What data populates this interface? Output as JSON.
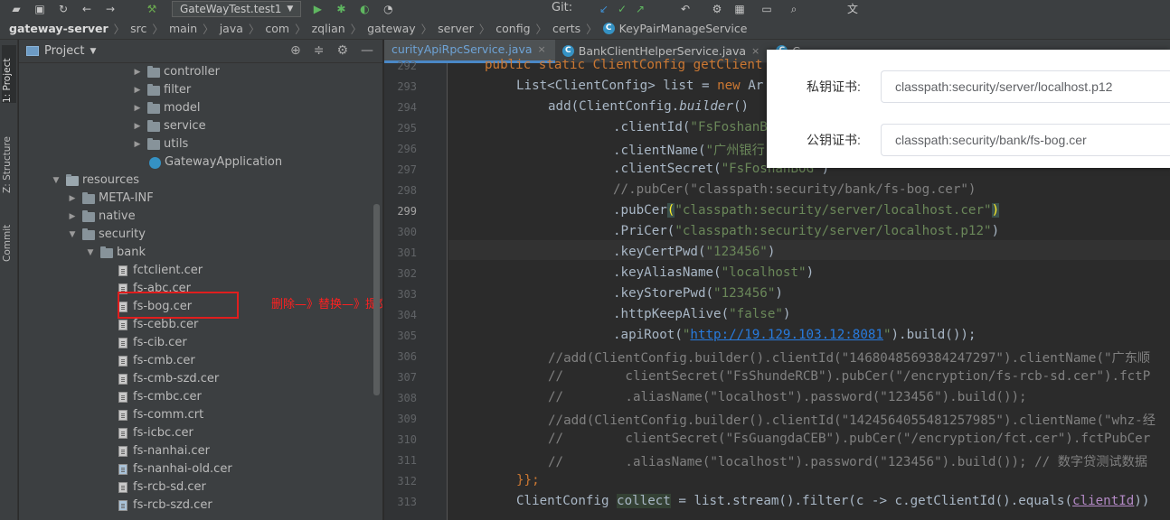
{
  "toolbar": {
    "run_config": "GateWayTest.test1",
    "git_label": "Git:"
  },
  "breadcrumb": [
    "gateway-server",
    "src",
    "main",
    "java",
    "com",
    "zqlian",
    "gateway",
    "server",
    "config",
    "certs",
    "KeyPairManageService"
  ],
  "left_strip": {
    "tabs": [
      "1: Project",
      "Z: Structure",
      "Commit"
    ]
  },
  "project": {
    "title": "Project",
    "tree": [
      {
        "label": "controller",
        "kind": "folder",
        "arrow": "▶"
      },
      {
        "label": "filter",
        "kind": "folder",
        "arrow": "▶"
      },
      {
        "label": "model",
        "kind": "folder",
        "arrow": "▶"
      },
      {
        "label": "service",
        "kind": "folder",
        "arrow": "▶"
      },
      {
        "label": "utils",
        "kind": "folder",
        "arrow": "▶"
      },
      {
        "label": "GatewayApplication",
        "kind": "app",
        "arrow": ""
      },
      {
        "label": "resources",
        "kind": "res",
        "arrow": "▼"
      },
      {
        "label": "META-INF",
        "kind": "folder",
        "arrow": "▶"
      },
      {
        "label": "native",
        "kind": "folder",
        "arrow": "▶"
      },
      {
        "label": "security",
        "kind": "folder",
        "arrow": "▼"
      },
      {
        "label": "bank",
        "kind": "folder",
        "arrow": "▼"
      },
      {
        "label": "fctclient.cer",
        "kind": "file",
        "arrow": ""
      },
      {
        "label": "fs-abc.cer",
        "kind": "file",
        "arrow": ""
      },
      {
        "label": "fs-bog.cer",
        "kind": "file",
        "arrow": ""
      },
      {
        "label": "fs-cebb.cer",
        "kind": "file",
        "arrow": ""
      },
      {
        "label": "fs-cib.cer",
        "kind": "file",
        "arrow": ""
      },
      {
        "label": "fs-cmb.cer",
        "kind": "file",
        "arrow": ""
      },
      {
        "label": "fs-cmb-szd.cer",
        "kind": "file",
        "arrow": ""
      },
      {
        "label": "fs-cmbc.cer",
        "kind": "file",
        "arrow": ""
      },
      {
        "label": "fs-comm.crt",
        "kind": "file",
        "arrow": ""
      },
      {
        "label": "fs-icbc.cer",
        "kind": "file",
        "arrow": ""
      },
      {
        "label": "fs-nanhai.cer",
        "kind": "file",
        "arrow": ""
      },
      {
        "label": "fs-nanhai-old.cer",
        "kind": "gitfile",
        "arrow": ""
      },
      {
        "label": "fs-rcb-sd.cer",
        "kind": "file",
        "arrow": ""
      },
      {
        "label": "fs-rcb-szd.cer",
        "kind": "gitfile",
        "arrow": ""
      }
    ],
    "annotation": "删除—》替换—》提交—》部署"
  },
  "editor": {
    "tabs": [
      {
        "label": "curityApiRpcService.java",
        "active": true
      },
      {
        "label": "BankClientHelperService.java",
        "active": false
      },
      {
        "label": "C",
        "active": false
      }
    ],
    "line_numbers": [
      "292",
      "293",
      "294",
      "295",
      "296",
      "297",
      "298",
      "299",
      "300",
      "301",
      "302",
      "303",
      "304",
      "305",
      "306",
      "307",
      "308",
      "309",
      "310",
      "311",
      "312",
      "313"
    ],
    "current_line": "299",
    "code": {
      "l292": "public static ClientConfig getClient",
      "l293_a": "List<ClientConfig> list = ",
      "l293_b": "new",
      "l293_c": " Ar",
      "l294_a": "add(ClientConfig.",
      "l294_b": "builder",
      "l294_c": "()",
      "l295_a": ".clientId(",
      "l295_b": "\"FsFoshanB",
      "l296_a": ".clientName(",
      "l296_b": "\"广州银行",
      "l297_a": ".clientSecret(",
      "l297_b": "\"FsFoshanBOG\"",
      "l297_c": ")",
      "l298": "//.pubCer(\"classpath:security/bank/fs-bog.cer\")",
      "l299_a": ".pubCer",
      "l299_b": "(",
      "l299_c": "\"classpath:security/server/localhost.cer\"",
      "l299_d": ")",
      "l300_a": ".PriCer(",
      "l300_b": "\"classpath:security/server/localhost.p12\"",
      "l300_c": ")",
      "l301_a": ".keyCertPwd(",
      "l301_b": "\"123456\"",
      "l301_c": ")",
      "l302_a": ".keyAliasName(",
      "l302_b": "\"localhost\"",
      "l302_c": ")",
      "l303_a": ".keyStorePwd(",
      "l303_b": "\"123456\"",
      "l303_c": ")",
      "l304_a": ".httpKeepAlive(",
      "l304_b": "\"false\"",
      "l304_c": ")",
      "l305_a": ".apiRoot(",
      "l305_b": "\"",
      "l305_url": "http://19.129.103.12:8081",
      "l305_c": "\"",
      "l305_d": ").build());",
      "l306": "//add(ClientConfig.builder().clientId(\"1468048569384247297\").clientName(\"广东顺",
      "l307": "//        clientSecret(\"FsShundeRCB\").pubCer(\"/encryption/fs-rcb-sd.cer\").fctP",
      "l308": "//        .aliasName(\"localhost\").password(\"123456\").build());",
      "l309": "//add(ClientConfig.builder().clientId(\"1424564055481257985\").clientName(\"whz-经",
      "l310": "//        clientSecret(\"FsGuangdaCEB\").pubCer(\"/encryption/fct.cer\").fctPubCer",
      "l311": "//        .aliasName(\"localhost\").password(\"123456\").build()); // 数字贷测试数据",
      "l312": "}};",
      "l313_a": "ClientConfig ",
      "l313_b": "collect",
      "l313_c": " = list.stream().filter(c -> c.getClientId().equals(",
      "l313_d": "clientId",
      "l313_e": "))"
    }
  },
  "overlay": {
    "private_label": "私钥证书:",
    "private_value": "classpath:security/server/localhost.p12",
    "public_label": "公钥证书:",
    "public_value": "classpath:security/bank/fs-bog.cer"
  },
  "colors": {
    "annotation": "#ff2020",
    "highlight_box": "#e01e1e",
    "active_tab_text": "#6ea3d6"
  }
}
